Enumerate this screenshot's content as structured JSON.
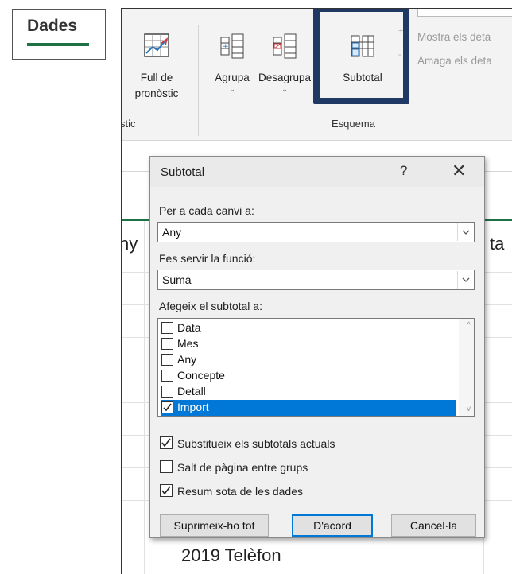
{
  "dades_tab": {
    "label": "Dades"
  },
  "ribbon": {
    "forecast_button": {
      "line1": "Full de",
      "line2": "pronòstic"
    },
    "group_button": {
      "label": "Agrupa"
    },
    "ungroup_button": {
      "label": "Desagrupa"
    },
    "subtotal_button": {
      "label": "Subtotal"
    },
    "show_detail": {
      "label": "Mostra els deta"
    },
    "hide_detail": {
      "label": "Amaga els deta"
    },
    "left_group_label": "stic",
    "outline_group_label": "Esquema"
  },
  "sheet": {
    "col_left_fragment": "ny",
    "col_right_fragment": "ta",
    "bottom_row_year": "2019",
    "bottom_row_concept": "Telèfon"
  },
  "dialog": {
    "title": "Subtotal",
    "help": "?",
    "close": "✕",
    "at_each_change_label": "Per a cada canvi a:",
    "at_each_change_value": "Any",
    "use_function_label": "Fes servir la funció:",
    "use_function_value": "Suma",
    "add_subtotal_label": "Afegeix el subtotal a:",
    "fields": [
      {
        "label": "Data",
        "checked": false
      },
      {
        "label": "Mes",
        "checked": false
      },
      {
        "label": "Any",
        "checked": false
      },
      {
        "label": "Concepte",
        "checked": false
      },
      {
        "label": "Detall",
        "checked": false
      },
      {
        "label": "Import",
        "checked": true
      }
    ],
    "options": {
      "replace_current": {
        "label": "Substitueix els subtotals actuals",
        "checked": true
      },
      "page_break": {
        "label": "Salt de pàgina entre grups",
        "checked": false
      },
      "summary_below": {
        "label": "Resum sota de les dades",
        "checked": true
      }
    },
    "buttons": {
      "remove_all": "Suprimeix-ho tot",
      "ok": "D'acord",
      "cancel": "Cancel·la"
    }
  },
  "colors": {
    "excel_green": "#1e7145",
    "highlight_navy": "#1f3864",
    "selection_blue": "#0078d7"
  }
}
